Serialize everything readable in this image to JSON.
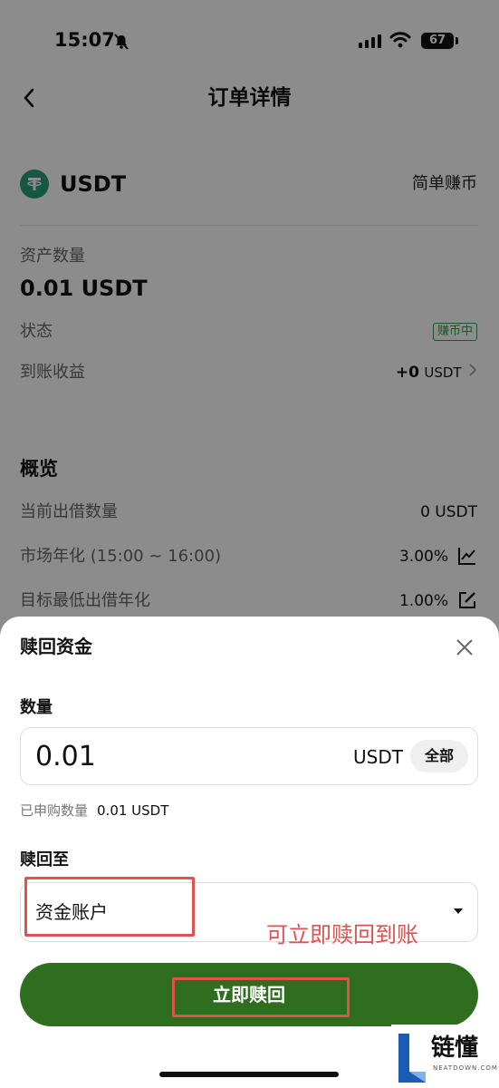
{
  "status_bar": {
    "time": "15:07",
    "battery": "67"
  },
  "nav": {
    "title": "订单详情"
  },
  "asset": {
    "coin": "USDT",
    "product_type": "简单赚币",
    "quantity_label": "资产数量",
    "quantity_value": "0.01 USDT",
    "status_label": "状态",
    "status_value": "赚币中",
    "earnings_label": "到账收益",
    "earnings_amount": "+0",
    "earnings_unit": "USDT"
  },
  "overview": {
    "title": "概览",
    "rows": [
      {
        "label": "当前出借数量",
        "value": "0 USDT"
      },
      {
        "label": "市场年化 (15:00 ~ 16:00)",
        "value": "3.00%",
        "icon": "chart-line-icon"
      },
      {
        "label": "目标最低出借年化",
        "value": "1.00%",
        "icon": "edit-icon"
      }
    ]
  },
  "sheet": {
    "title": "赎回资金",
    "quantity_label": "数量",
    "quantity_value": "0.01",
    "quantity_unit": "USDT",
    "all_label": "全部",
    "subscribed_label": "已申购数量",
    "subscribed_value": "0.01 USDT",
    "redeem_to_label": "赎回至",
    "redeem_to_value": "资金账户",
    "annotation": "可立即赎回到账",
    "redeem_button": "立即赎回"
  },
  "watermark": {
    "name": "链懂",
    "sub": "NEATDOWN.COM"
  },
  "colors": {
    "accent_green": "#2f6e1f",
    "badge_green": "#3a9b4c",
    "tether": "#26a17b",
    "annotation_red": "#e0524f"
  }
}
